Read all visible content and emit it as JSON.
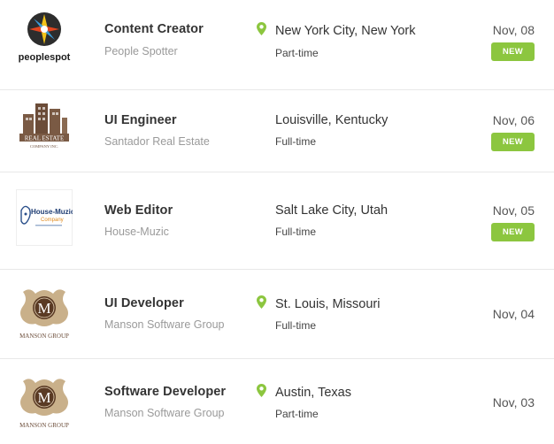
{
  "colors": {
    "accent": "#8cc63f",
    "title": "#333333",
    "muted": "#9a9a9a",
    "divider": "#e8e8e8"
  },
  "jobs": [
    {
      "title": "Content Creator",
      "company": "People Spotter",
      "location": "New York City, New York",
      "type": "Part-time",
      "date": "Nov, 08",
      "badge": "NEW",
      "logo_icon": "peoplespot-logo",
      "logo_text": "peoplespot",
      "pin_icon": "map-pin-icon"
    },
    {
      "title": "UI Engineer",
      "company": "Santador Real Estate",
      "location": "Louisville, Kentucky",
      "type": "Full-time",
      "date": "Nov, 06",
      "badge": "NEW",
      "logo_icon": "real-estate-logo",
      "logo_text": "REAL ESTATE",
      "logo_subtext": "COMPANY INC."
    },
    {
      "title": "Web Editor",
      "company": "House-Muzic",
      "location": "Salt Lake City, Utah",
      "type": "Full-time",
      "date": "Nov, 05",
      "badge": "NEW",
      "logo_icon": "house-muzic-logo",
      "logo_text": "House-Muzic",
      "logo_subtext": "Company"
    },
    {
      "title": "UI Developer",
      "company": "Manson Software Group",
      "location": "St. Louis, Missouri",
      "type": "Full-time",
      "date": "Nov, 04",
      "logo_icon": "manson-group-logo",
      "logo_text": "MANSON GROUP",
      "logo_letter": "M",
      "pin_icon": "map-pin-icon"
    },
    {
      "title": "Software Developer",
      "company": "Manson Software Group",
      "location": "Austin, Texas",
      "type": "Part-time",
      "date": "Nov, 03",
      "logo_icon": "manson-group-logo",
      "logo_text": "MANSON GROUP",
      "logo_letter": "M",
      "pin_icon": "map-pin-icon"
    }
  ]
}
